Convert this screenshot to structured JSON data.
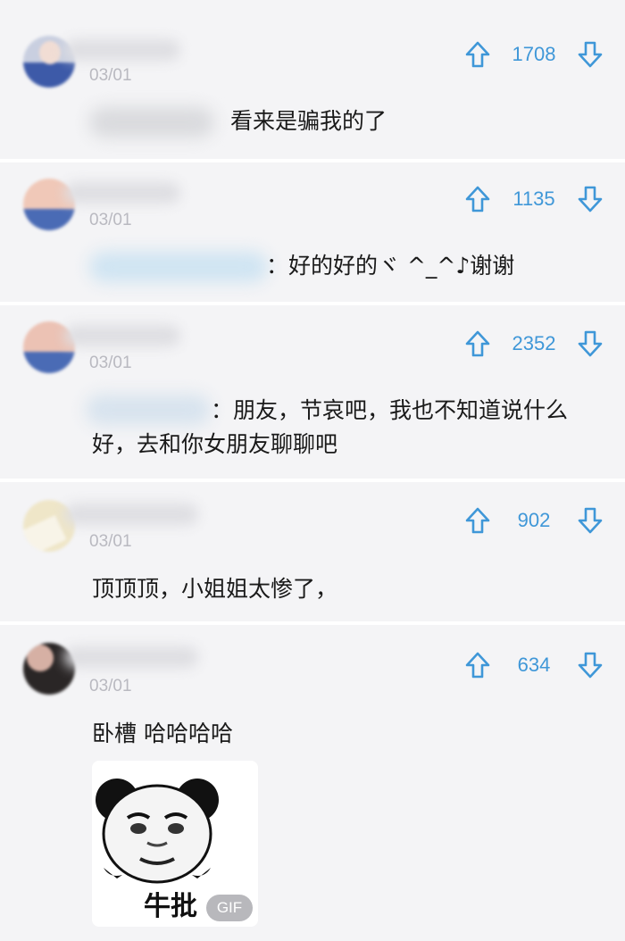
{
  "icons": {
    "upvote": "arrow-up-icon",
    "downvote": "arrow-down-icon"
  },
  "colors": {
    "accent": "#3f97d8",
    "date": "#b9b9c0",
    "text": "#1a1a1a"
  },
  "comments": [
    {
      "date": "03/01",
      "votes": "1708",
      "text": "看来是骗我的了"
    },
    {
      "date": "03/01",
      "votes": "1135",
      "text": "：好的好的ヾ ^_^♪谢谢"
    },
    {
      "date": "03/01",
      "votes": "2352",
      "text_line1": "：朋友，节哀吧，我也不知道说什么",
      "text_line2": "好，去和你女朋友聊聊吧"
    },
    {
      "date": "03/01",
      "votes": "902",
      "text": "顶顶顶，小姐姐太惨了，"
    },
    {
      "date": "03/01",
      "votes": "634",
      "text": "卧槽 哈哈哈哈",
      "gif": {
        "caption": "牛批",
        "badge": "GIF"
      }
    }
  ]
}
